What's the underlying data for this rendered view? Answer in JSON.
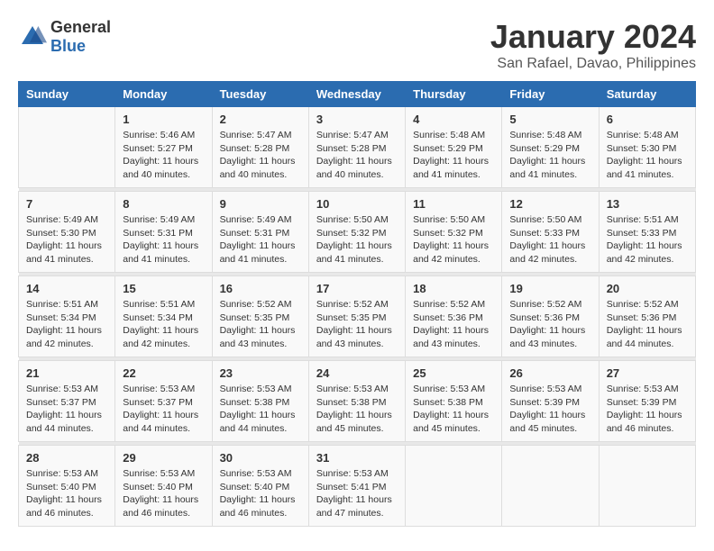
{
  "logo": {
    "general": "General",
    "blue": "Blue"
  },
  "title": "January 2024",
  "subtitle": "San Rafael, Davao, Philippines",
  "days_header": [
    "Sunday",
    "Monday",
    "Tuesday",
    "Wednesday",
    "Thursday",
    "Friday",
    "Saturday"
  ],
  "weeks": [
    [
      {
        "day": "",
        "sunrise": "",
        "sunset": "",
        "daylight": ""
      },
      {
        "day": "1",
        "sunrise": "Sunrise: 5:46 AM",
        "sunset": "Sunset: 5:27 PM",
        "daylight": "Daylight: 11 hours and 40 minutes."
      },
      {
        "day": "2",
        "sunrise": "Sunrise: 5:47 AM",
        "sunset": "Sunset: 5:28 PM",
        "daylight": "Daylight: 11 hours and 40 minutes."
      },
      {
        "day": "3",
        "sunrise": "Sunrise: 5:47 AM",
        "sunset": "Sunset: 5:28 PM",
        "daylight": "Daylight: 11 hours and 40 minutes."
      },
      {
        "day": "4",
        "sunrise": "Sunrise: 5:48 AM",
        "sunset": "Sunset: 5:29 PM",
        "daylight": "Daylight: 11 hours and 41 minutes."
      },
      {
        "day": "5",
        "sunrise": "Sunrise: 5:48 AM",
        "sunset": "Sunset: 5:29 PM",
        "daylight": "Daylight: 11 hours and 41 minutes."
      },
      {
        "day": "6",
        "sunrise": "Sunrise: 5:48 AM",
        "sunset": "Sunset: 5:30 PM",
        "daylight": "Daylight: 11 hours and 41 minutes."
      }
    ],
    [
      {
        "day": "7",
        "sunrise": "Sunrise: 5:49 AM",
        "sunset": "Sunset: 5:30 PM",
        "daylight": "Daylight: 11 hours and 41 minutes."
      },
      {
        "day": "8",
        "sunrise": "Sunrise: 5:49 AM",
        "sunset": "Sunset: 5:31 PM",
        "daylight": "Daylight: 11 hours and 41 minutes."
      },
      {
        "day": "9",
        "sunrise": "Sunrise: 5:49 AM",
        "sunset": "Sunset: 5:31 PM",
        "daylight": "Daylight: 11 hours and 41 minutes."
      },
      {
        "day": "10",
        "sunrise": "Sunrise: 5:50 AM",
        "sunset": "Sunset: 5:32 PM",
        "daylight": "Daylight: 11 hours and 41 minutes."
      },
      {
        "day": "11",
        "sunrise": "Sunrise: 5:50 AM",
        "sunset": "Sunset: 5:32 PM",
        "daylight": "Daylight: 11 hours and 42 minutes."
      },
      {
        "day": "12",
        "sunrise": "Sunrise: 5:50 AM",
        "sunset": "Sunset: 5:33 PM",
        "daylight": "Daylight: 11 hours and 42 minutes."
      },
      {
        "day": "13",
        "sunrise": "Sunrise: 5:51 AM",
        "sunset": "Sunset: 5:33 PM",
        "daylight": "Daylight: 11 hours and 42 minutes."
      }
    ],
    [
      {
        "day": "14",
        "sunrise": "Sunrise: 5:51 AM",
        "sunset": "Sunset: 5:34 PM",
        "daylight": "Daylight: 11 hours and 42 minutes."
      },
      {
        "day": "15",
        "sunrise": "Sunrise: 5:51 AM",
        "sunset": "Sunset: 5:34 PM",
        "daylight": "Daylight: 11 hours and 42 minutes."
      },
      {
        "day": "16",
        "sunrise": "Sunrise: 5:52 AM",
        "sunset": "Sunset: 5:35 PM",
        "daylight": "Daylight: 11 hours and 43 minutes."
      },
      {
        "day": "17",
        "sunrise": "Sunrise: 5:52 AM",
        "sunset": "Sunset: 5:35 PM",
        "daylight": "Daylight: 11 hours and 43 minutes."
      },
      {
        "day": "18",
        "sunrise": "Sunrise: 5:52 AM",
        "sunset": "Sunset: 5:36 PM",
        "daylight": "Daylight: 11 hours and 43 minutes."
      },
      {
        "day": "19",
        "sunrise": "Sunrise: 5:52 AM",
        "sunset": "Sunset: 5:36 PM",
        "daylight": "Daylight: 11 hours and 43 minutes."
      },
      {
        "day": "20",
        "sunrise": "Sunrise: 5:52 AM",
        "sunset": "Sunset: 5:36 PM",
        "daylight": "Daylight: 11 hours and 44 minutes."
      }
    ],
    [
      {
        "day": "21",
        "sunrise": "Sunrise: 5:53 AM",
        "sunset": "Sunset: 5:37 PM",
        "daylight": "Daylight: 11 hours and 44 minutes."
      },
      {
        "day": "22",
        "sunrise": "Sunrise: 5:53 AM",
        "sunset": "Sunset: 5:37 PM",
        "daylight": "Daylight: 11 hours and 44 minutes."
      },
      {
        "day": "23",
        "sunrise": "Sunrise: 5:53 AM",
        "sunset": "Sunset: 5:38 PM",
        "daylight": "Daylight: 11 hours and 44 minutes."
      },
      {
        "day": "24",
        "sunrise": "Sunrise: 5:53 AM",
        "sunset": "Sunset: 5:38 PM",
        "daylight": "Daylight: 11 hours and 45 minutes."
      },
      {
        "day": "25",
        "sunrise": "Sunrise: 5:53 AM",
        "sunset": "Sunset: 5:38 PM",
        "daylight": "Daylight: 11 hours and 45 minutes."
      },
      {
        "day": "26",
        "sunrise": "Sunrise: 5:53 AM",
        "sunset": "Sunset: 5:39 PM",
        "daylight": "Daylight: 11 hours and 45 minutes."
      },
      {
        "day": "27",
        "sunrise": "Sunrise: 5:53 AM",
        "sunset": "Sunset: 5:39 PM",
        "daylight": "Daylight: 11 hours and 46 minutes."
      }
    ],
    [
      {
        "day": "28",
        "sunrise": "Sunrise: 5:53 AM",
        "sunset": "Sunset: 5:40 PM",
        "daylight": "Daylight: 11 hours and 46 minutes."
      },
      {
        "day": "29",
        "sunrise": "Sunrise: 5:53 AM",
        "sunset": "Sunset: 5:40 PM",
        "daylight": "Daylight: 11 hours and 46 minutes."
      },
      {
        "day": "30",
        "sunrise": "Sunrise: 5:53 AM",
        "sunset": "Sunset: 5:40 PM",
        "daylight": "Daylight: 11 hours and 46 minutes."
      },
      {
        "day": "31",
        "sunrise": "Sunrise: 5:53 AM",
        "sunset": "Sunset: 5:41 PM",
        "daylight": "Daylight: 11 hours and 47 minutes."
      },
      {
        "day": "",
        "sunrise": "",
        "sunset": "",
        "daylight": ""
      },
      {
        "day": "",
        "sunrise": "",
        "sunset": "",
        "daylight": ""
      },
      {
        "day": "",
        "sunrise": "",
        "sunset": "",
        "daylight": ""
      }
    ]
  ]
}
